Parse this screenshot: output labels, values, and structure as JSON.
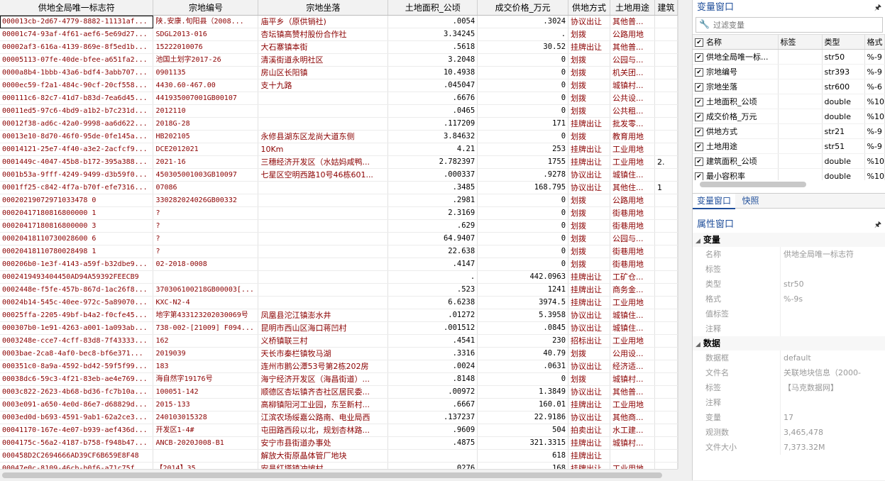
{
  "grid": {
    "columns": [
      "供地全局唯一标志符",
      "宗地编号",
      "宗地坐落",
      "土地面积_公顷",
      "成交价格_万元",
      "供地方式",
      "土地用途",
      "建筑"
    ],
    "rows": [
      [
        "000013cb-2d67-4779-8882-11131af...",
        "陕.安康.旬阳县（2008...",
        "庙平乡（原供销社)",
        ".0054",
        ".3024",
        "协议出让",
        "其他普...",
        " "
      ],
      [
        "00001c74-93af-4f61-aef6-5e69d27...",
        "SDGL2013-016",
        "杏坛镇高赞村股份合作社",
        "3.34245",
        ".",
        "划拨",
        "公路用地",
        ""
      ],
      [
        "00002af3-616a-4139-869e-8f5ed1b...",
        "15222010076",
        "大石寨镇本街",
        ".5618",
        "30.52",
        "挂牌出让",
        "其他普...",
        ""
      ],
      [
        "00005113-07fe-40de-bfee-a651fa2...",
        "池国土划字2017-26",
        "清溪街道永明社区",
        "3.2048",
        "0",
        "划拨",
        "公园与...",
        ""
      ],
      [
        "0000a8b4-1bbb-43a6-bdf4-3abb707...",
        "0901135",
        "房山区长阳镇",
        "10.4938",
        "0",
        "划拨",
        "机关团...",
        ""
      ],
      [
        "0000ec59-f2a1-484c-90cf-20cf558...",
        "4430.60-467.00",
        "支十九路",
        ".045047",
        "0",
        "划拨",
        "城镇村...",
        ""
      ],
      [
        "000111c6-82c7-41d7-b83d-7ea6d45...",
        "441935007001GB00107",
        "",
        ".6676",
        "0",
        "划拨",
        "公共设...",
        ""
      ],
      [
        "00011ed5-97c6-4bd9-a1b2-b7c231d...",
        "2012110",
        "",
        ".0465",
        "0",
        "划拨",
        "公共租...",
        ""
      ],
      [
        "00012f38-ad6c-42a0-9998-aa6d622...",
        "2018G-28",
        "",
        ".117209",
        "171",
        "挂牌出让",
        "批发零...",
        ""
      ],
      [
        "00013e10-8d70-46f0-95de-0fe145a...",
        "HB202105",
        "永修县湖东区龙尚大道东侧",
        "3.84632",
        "0",
        "划拨",
        "教育用地",
        ""
      ],
      [
        "00014121-25e7-4f40-a3e2-2acfcf9...",
        "DCE2012021",
        "10Km",
        "4.21",
        "253",
        "挂牌出让",
        "工业用地",
        ""
      ],
      [
        "0001449c-4047-45b8-b172-395a388...",
        "2021-16",
        "三穗经济开发区（水姑妈咸鸭...",
        "2.782397",
        "1755",
        "挂牌出让",
        "工业用地",
        "2."
      ],
      [
        "0001b53a-9fff-4249-9499-d3b59f0...",
        "450305001003GB10097",
        "七星区空明西路10号46栋601...",
        ".000337",
        ".9278",
        "协议出让",
        "城镇住...",
        ""
      ],
      [
        "0001ff25-c842-4f7a-b70f-efe7316...",
        "07086",
        "",
        ".3485",
        "168.795",
        "协议出让",
        "其他住...",
        "1"
      ],
      [
        "00020219072971033478 0",
        "330282024026GB00332",
        "",
        ".2981",
        "0",
        "划拨",
        "公路用地",
        ""
      ],
      [
        "00020417180816800000 1",
        "?",
        "",
        "2.3169",
        "0",
        "划拨",
        "街巷用地",
        ""
      ],
      [
        "00020417180816800000 3",
        "?",
        "",
        ".629",
        "0",
        "划拨",
        "街巷用地",
        ""
      ],
      [
        "00020418110730028600 6",
        "?",
        "",
        "64.9407",
        "0",
        "划拨",
        "公园与...",
        ""
      ],
      [
        "00020418110780028498 1",
        "?",
        "",
        "22.638",
        "0",
        "划拨",
        "街巷用地",
        ""
      ],
      [
        "000206b0-1e3f-4143-a59f-b32dbe9...",
        "02-2018-0008",
        "",
        ".4147",
        "0",
        "划拨",
        "街巷用地",
        ""
      ],
      [
        "0002419493404450AD94A59392FEECB9",
        "",
        "",
        ".",
        "442.0963",
        "挂牌出让",
        "工矿仓...",
        ""
      ],
      [
        "0002448e-f5fe-457b-867d-1ac26f8...",
        "370306100218GB00003[...",
        "",
        ".523",
        "1241",
        "挂牌出让",
        "商务金...",
        ""
      ],
      [
        "00024b14-545c-40ee-972c-5a89070...",
        "KXC-N2-4",
        "",
        "6.6238",
        "3974.5",
        "挂牌出让",
        "工业用地",
        ""
      ],
      [
        "00025ffa-2205-49bf-b4a2-f0cfe45...",
        "地字第433123202030069号",
        "凤凰县沱江镇澎水井",
        ".01272",
        "5.3958",
        "协议出让",
        "城镇住...",
        ""
      ],
      [
        "000307b0-1e91-4263-a001-1a093ab...",
        "738-002-[21009] F094...",
        "昆明市西山区海口蒋凹村",
        ".001512",
        ".0845",
        "协议出让",
        "城镇住...",
        ""
      ],
      [
        "0003248e-cce7-4cff-83d8-7f43333...",
        "162",
        "义桥镇联三村",
        ".4541",
        "230",
        "招标出让",
        "工业用地",
        ""
      ],
      [
        "0003bae-2ca8-4af0-bec8-bf6e371...",
        "2019039",
        "天长市秦栏镇牧马湖",
        ".3316",
        "40.79",
        "划拨",
        "公用设...",
        ""
      ],
      [
        "000351c0-8a9a-4592-bd42-59f5f99...",
        "183",
        "连州市鹅公潭53号第2栋202房",
        ".0024",
        ".0631",
        "协议出让",
        "经济适...",
        ""
      ],
      [
        "00038dc6-59c3-4f21-83eb-ae4e769...",
        "海自然字19176号",
        "海宁经济开发区（海昌街道）...",
        ".8148",
        "0",
        "划拨",
        "城镇村...",
        ""
      ],
      [
        "0003c822-2623-4b68-bd36-fc7b10a...",
        "100051-142",
        "顺德区杏坛镇齐杏社区居民委...",
        ".00972",
        "1.3849",
        "协议出让",
        "其他普...",
        ""
      ],
      [
        "0003e091-a650-4e0d-86e7-d68829d...",
        "2015-133",
        "高柳镇阳河工业园，东至新村...",
        ".6667",
        "160.01",
        "挂牌出让",
        "工业用地",
        ""
      ],
      [
        "0003ed0d-b693-4591-9ab1-62a2ce3...",
        "240103015328",
        "江滨农场绥嘉公路南、电业局西",
        ".137237",
        "22.9186",
        "协议出让",
        "其他商...",
        ""
      ],
      [
        "00041170-167e-4e07-b939-aef436d...",
        "开发区1-4#",
        "屯田路西段以北，规划杏林路...",
        ".9609",
        "504",
        "拍卖出让",
        "水工建...",
        ""
      ],
      [
        "0004175c-56a2-4187-b758-f948b47...",
        "ANCB-2020J008-B1",
        "安宁市县街道办事处",
        ".4875",
        "321.3315",
        "挂牌出让",
        "城镇村...",
        ""
      ],
      [
        "000458D2C2694666AD39CF6B659E8F48",
        "",
        "解放大街原晶体管厂地块",
        "",
        "618",
        "挂牌出让",
        "",
        ""
      ],
      [
        "00047e0c-8109-46cb-b0f6-a71c75f...",
        "【2014】35",
        "安昌红塔镇冲坡村",
        ".0276",
        "168",
        "挂牌出让",
        "工业用地",
        ""
      ]
    ]
  },
  "variables_panel": {
    "title": "变量窗口",
    "filter_placeholder": "过滤变量",
    "headers": [
      "名称",
      "标签",
      "类型",
      "格式"
    ],
    "items": [
      {
        "name": "供地全局唯一标...",
        "label": "",
        "type": "str50",
        "format": "%-9"
      },
      {
        "name": "宗地编号",
        "label": "",
        "type": "str393",
        "format": "%-9"
      },
      {
        "name": "宗地坐落",
        "label": "",
        "type": "str600",
        "format": "%-6"
      },
      {
        "name": "土地面积_公顷",
        "label": "",
        "type": "double",
        "format": "%10"
      },
      {
        "name": "成交价格_万元",
        "label": "",
        "type": "double",
        "format": "%10"
      },
      {
        "name": "供地方式",
        "label": "",
        "type": "str21",
        "format": "%-9"
      },
      {
        "name": "土地用途",
        "label": "",
        "type": "str51",
        "format": "%-9"
      },
      {
        "name": "建筑面积_公顷",
        "label": "",
        "type": "double",
        "format": "%10"
      },
      {
        "name": "最小容积率",
        "label": "",
        "type": "double",
        "format": "%10"
      },
      {
        "name": "最小绿化率_百...",
        "label": "",
        "type": "double",
        "format": "%10"
      }
    ],
    "tabs": [
      "变量窗口",
      "快照"
    ]
  },
  "properties_panel": {
    "title": "属性窗口",
    "sections": [
      {
        "name": "变量",
        "props": [
          {
            "k": "名称",
            "v": "供地全局唯一标志符"
          },
          {
            "k": "标签",
            "v": ""
          },
          {
            "k": "类型",
            "v": "str50"
          },
          {
            "k": "格式",
            "v": "%-9s"
          },
          {
            "k": "值标签",
            "v": ""
          },
          {
            "k": "注释",
            "v": ""
          }
        ]
      },
      {
        "name": "数据",
        "props": [
          {
            "k": "数据框",
            "v": "default"
          },
          {
            "k": "文件名",
            "v": "关联地块信息（2000-"
          },
          {
            "k": "标签",
            "v": "【马克数据网】"
          },
          {
            "k": "注释",
            "v": ""
          },
          {
            "k": "变量",
            "v": "17"
          },
          {
            "k": "观测数",
            "v": "3,465,478"
          },
          {
            "k": "文件大小",
            "v": "7,373.32M"
          }
        ]
      }
    ]
  },
  "icons": {
    "pin": "pin-icon",
    "wrench": "wrench-icon",
    "checkbox": "checkbox-icon"
  }
}
